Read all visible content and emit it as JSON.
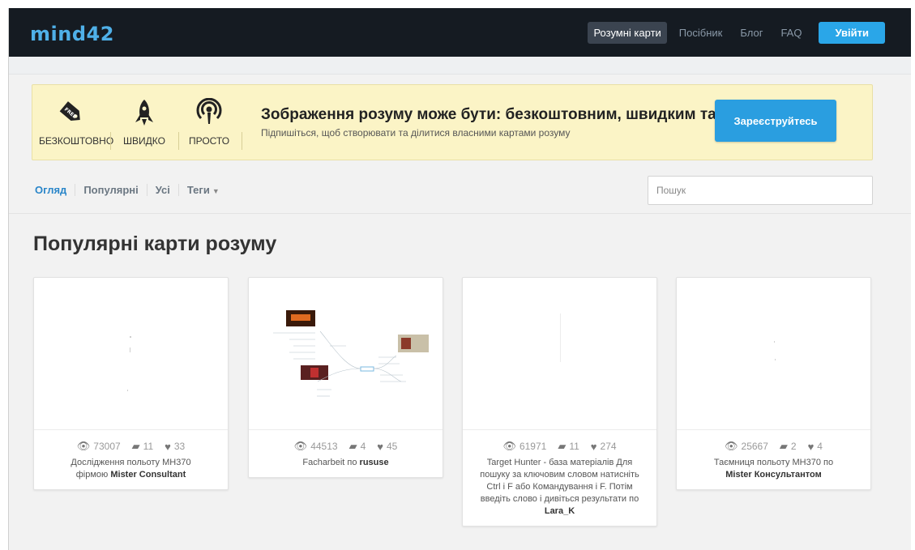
{
  "header": {
    "logo": "mind42",
    "nav": [
      {
        "label": "Розумні карти",
        "active": true
      },
      {
        "label": "Посібник",
        "active": false
      },
      {
        "label": "Блог",
        "active": false
      },
      {
        "label": "FAQ",
        "active": false
      }
    ],
    "login_label": "Увійти"
  },
  "promo": {
    "features": [
      {
        "label": "БЕЗКОШТОВНО",
        "icon": "price-tag-icon"
      },
      {
        "label": "ШВИДКО",
        "icon": "rocket-icon"
      },
      {
        "label": "ПРОСТО",
        "icon": "broadcast-icon"
      }
    ],
    "title": "Зображення розуму може бути: безкоштовним, швидким та простим",
    "subtitle": "Підпишіться, щоб створювати та ділитися власними картами розуму",
    "signup_label": "Зареєструйтесь"
  },
  "tabs": [
    {
      "label": "Огляд",
      "active": true
    },
    {
      "label": "Популярні",
      "active": false
    },
    {
      "label": "Усі",
      "active": false
    },
    {
      "label": "Теги",
      "active": false,
      "dropdown": true
    }
  ],
  "search": {
    "placeholder": "Пошук",
    "value": ""
  },
  "section_title": "Популярні карти розуму",
  "cards": [
    {
      "views": "73007",
      "comments": "11",
      "likes": "33",
      "title": "Дослідження польоту МН370",
      "by": "фірмою",
      "author": "Mister Consultant"
    },
    {
      "views": "44513",
      "comments": "4",
      "likes": "45",
      "title": "Facharbeit",
      "by": "по",
      "author": "rususe"
    },
    {
      "views": "61971",
      "comments": "11",
      "likes": "274",
      "title": "Target Hunter - база матеріалів Для пошуку за ключовим словом натисніть Ctrl і F або Командування і F. Потім введіть слово і дивіться результати",
      "by": "по",
      "author": "Lara_K"
    },
    {
      "views": "25667",
      "comments": "2",
      "likes": "4",
      "title": "Таємниця польоту МН370",
      "by": "по",
      "author": "Mister Консультантом"
    }
  ],
  "colors": {
    "topbar": "#151b22",
    "accent": "#2aa6e8",
    "promo_bg": "#fbf4c6",
    "active_tab": "#2a86c9"
  }
}
